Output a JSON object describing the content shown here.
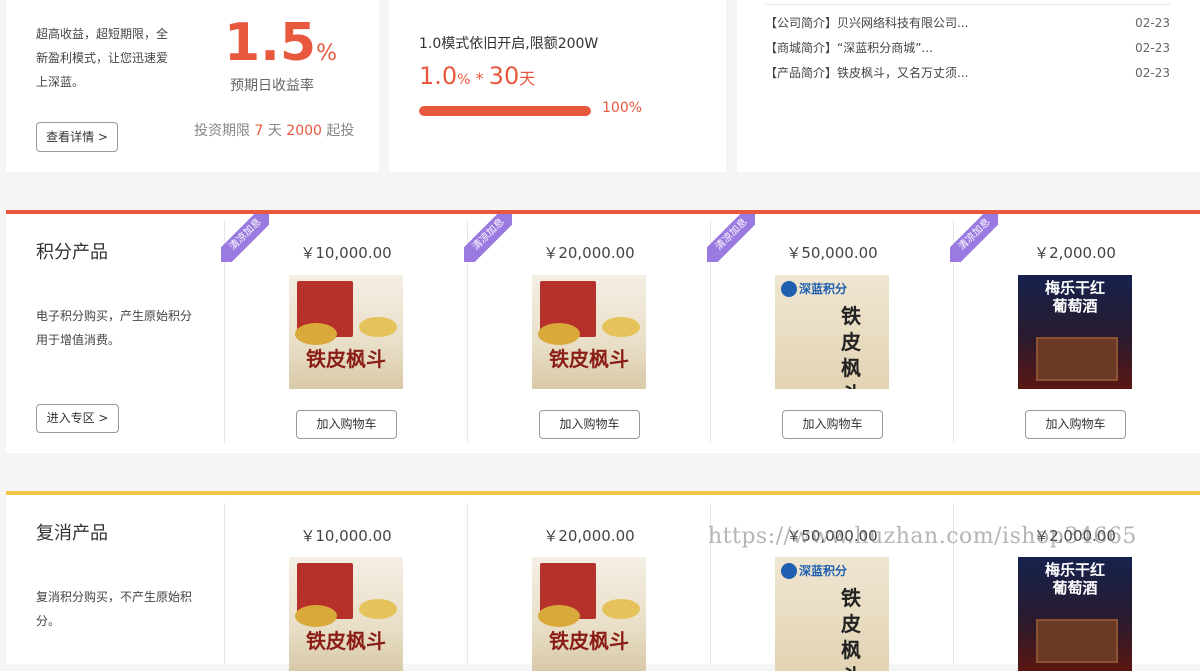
{
  "top": {
    "card1": {
      "desc": "超高收益，超短期限，全新盈利模式，让您迅速爱上深蓝。",
      "rate_value": "1.5",
      "rate_unit": "%",
      "rate_label": "预期日收益率",
      "details_button": "查看详情 >",
      "term_prefix": "投资期限",
      "term_days": "7",
      "term_days_unit": "天",
      "term_amount": "2000",
      "term_suffix": "起投"
    },
    "card2": {
      "title": "1.0模式依旧开启,限额200W",
      "rate": "1.0",
      "rate_unit": "%",
      "times": "*",
      "days": "30",
      "days_unit": "天",
      "progress_label": "100%",
      "progress_value": 1.0
    },
    "news": [
      {
        "text": "【公司简介】贝兴网络科技有限公司...",
        "date": "02-23"
      },
      {
        "text": "【商城简介】“深蓝积分商城”...",
        "date": "02-23"
      },
      {
        "text": "【产品简介】铁皮枫斗，又名万丈须...",
        "date": "02-23"
      }
    ]
  },
  "sections": [
    {
      "title": "积分产品",
      "desc": "电子积分购买，产生原始积分用于增值消费。",
      "enter_button": "进入专区 >",
      "bar_color": "#e8583f",
      "products": [
        {
          "badge": "清凉加息",
          "price": "￥10,000.00",
          "image": "tea-box-image",
          "image_text": "铁皮枫斗",
          "cart": "加入购物车"
        },
        {
          "badge": "清凉加息",
          "price": "￥20,000.00",
          "image": "tea-box-image",
          "image_text": "铁皮枫斗",
          "cart": "加入购物车"
        },
        {
          "badge": "清凉加息",
          "price": "￥50,000.00",
          "image": "poster-image",
          "image_text": "深蓝积分",
          "image_text2": "铁皮枫斗",
          "cart": "加入购物车"
        },
        {
          "badge": "清凉加息",
          "price": "￥2,000.00",
          "image": "wine-box-image",
          "image_text": "梅乐干红",
          "image_text2": "葡萄酒",
          "cart": "加入购物车"
        }
      ]
    },
    {
      "title": "复消产品",
      "desc": "复消积分购买，不产生原始积分。",
      "bar_color": "#f2c54a",
      "products": [
        {
          "price": "￥10,000.00",
          "image": "tea-box-image",
          "image_text": "铁皮枫斗"
        },
        {
          "price": "￥20,000.00",
          "image": "tea-box-image",
          "image_text": "铁皮枫斗"
        },
        {
          "price": "￥50,000.00",
          "image": "poster-image",
          "image_text": "深蓝积分",
          "image_text2": "铁皮枫斗"
        },
        {
          "price": "￥2,000.00",
          "image": "wine-box-image",
          "image_text": "梅乐干红",
          "image_text2": "葡萄酒"
        }
      ]
    }
  ],
  "watermark": "https://www.huzhan.com/ishop34665",
  "colors": {
    "accent": "#e8583f",
    "badge": "#9a79e0",
    "gold": "#f2c54a"
  }
}
